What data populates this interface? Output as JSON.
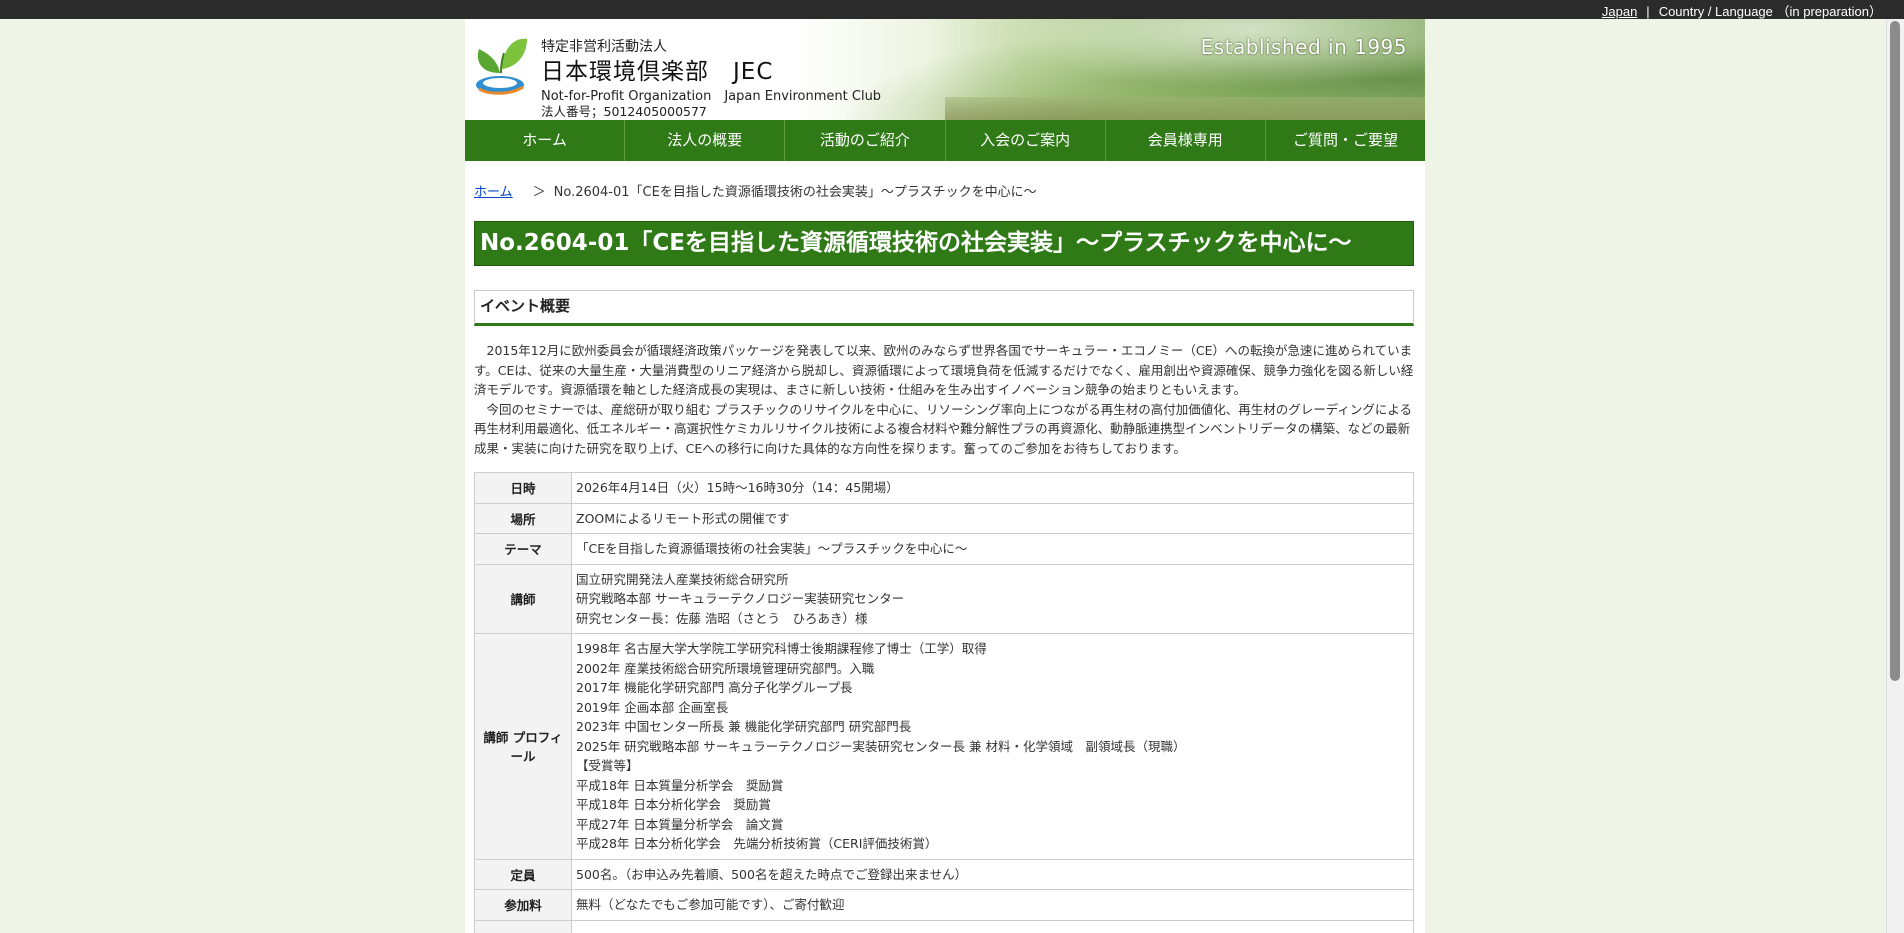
{
  "topbar": {
    "japan_link": "Japan",
    "separator": "|",
    "country_language": "Country / Language （in preparation）"
  },
  "header": {
    "line1": "特定非営利活動法人",
    "line2": "日本環境倶楽部　JEC",
    "line3": "Not-for-Profit Organization　Japan Environment Club",
    "line4": "法人番号；5012405000577",
    "established": "Established in 1995"
  },
  "nav": {
    "items": [
      {
        "label": "ホーム"
      },
      {
        "label": "法人の概要"
      },
      {
        "label": "活動のご紹介"
      },
      {
        "label": "入会のご案内"
      },
      {
        "label": "会員様専用"
      },
      {
        "label": "ご質問・ご要望"
      }
    ]
  },
  "breadcrumb": {
    "home": "ホーム",
    "separator": "＞",
    "current": "No.2604-01「CEを目指した資源循環技術の社会実装」～プラスチックを中心に～"
  },
  "main": {
    "title": "No.2604-01「CEを目指した資源循環技術の社会実装」～プラスチックを中心に～",
    "section_heading": "イベント概要",
    "intro": {
      "p1": "2015年12月に欧州委員会が循環経済政策パッケージを発表して以来、欧州のみならず世界各国でサーキュラー・エコノミー（CE）への転換が急速に進められています。CEは、従来の大量生産・大量消費型のリニア経済から脱却し、資源循環によって環境負荷を低減するだけでなく、雇用創出や資源確保、競争力強化を図る新しい経済モデルです。資源循環を軸とした経済成長の実現は、まさに新しい技術・仕組みを生み出すイノベーション競争の始まりともいえます。",
      "p2": "今回のセミナーでは、産総研が取り組む プラスチックのリサイクルを中心に、リソーシング率向上につながる再生材の高付加価値化、再生材のグレーディングによる再生材利用最適化、低エネルギー・高選択性ケミカルリサイクル技術による複合材料や難分解性プラの再資源化、動静脈連携型インベントリデータの構築、などの最新成果・実装に向けた研究を取り上げ、CEへの移行に向けた具体的な方向性を探ります。奮ってのご参加をお待ちしております。"
    },
    "table": {
      "datetime": {
        "label": "日時",
        "value": "2026年4月14日（火）15時～16時30分（14：45開場）"
      },
      "place": {
        "label": "場所",
        "value": "ZOOMによるリモート形式の開催です"
      },
      "theme": {
        "label": "テーマ",
        "value": "「CEを目指した資源循環技術の社会実装」～プラスチックを中心に～"
      },
      "lecturer": {
        "label": "講師",
        "lines": [
          "国立研究開発法人産業技術総合研究所",
          "研究戦略本部 サーキュラーテクノロジー実装研究センター",
          "研究センター長：佐藤 浩昭（さとう　ひろあき）様"
        ]
      },
      "profile": {
        "label_line1": "講師",
        "label_line2": "プロフィール",
        "lines": [
          "1998年 名古屋大学大学院工学研究科博士後期課程修了博士（工学）取得",
          "2002年 産業技術総合研究所環境管理研究部門。入職",
          "2017年 機能化学研究部門 高分子化学グループ長",
          "2019年 企画本部 企画室長",
          "2023年 中国センター所長 兼 機能化学研究部門 研究部門長",
          "2025年 研究戦略本部 サーキュラーテクノロジー実装研究センター長 兼 材料・化学領域　副領域長（現職）",
          "【受賞等】",
          "平成18年 日本質量分析学会　奨励賞",
          "平成18年 日本分析化学会　奨励賞",
          "平成27年 日本質量分析学会　論文賞",
          "平成28年 日本分析化学会　先端分析技術賞（CERI評価技術賞）"
        ]
      },
      "capacity": {
        "label": "定員",
        "value": "500名。（お申込み先着順、500名を超えた時点でご登録出来ません）"
      },
      "fee": {
        "label": "参加料",
        "value": "無料（どなたでもご参加可能です）、ご寄付歓迎"
      }
    }
  },
  "colors": {
    "nav_green": "#2f7a17",
    "page_bg": "#eef5e6",
    "link_blue": "#0645c8",
    "topbar_bg": "#2b2b2b"
  },
  "icons": {
    "logo": "sprout-logo-icon"
  }
}
